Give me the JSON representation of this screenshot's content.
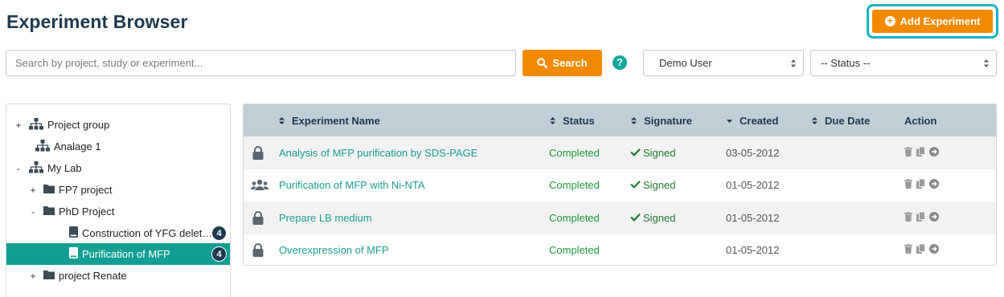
{
  "page": {
    "title": "Experiment Browser",
    "add_button_label": "Add Experiment",
    "accent_color": "#f28a00",
    "teal_color": "#129e93"
  },
  "search": {
    "placeholder": "Search by project, study or experiment...",
    "button_label": "Search",
    "help_label": "?"
  },
  "filters": {
    "user_value": "Demo User",
    "status_value": "-- Status --"
  },
  "tree": {
    "items": [
      {
        "label": "Project group",
        "toggle": "+",
        "icon": "hierarchy-icon"
      },
      {
        "label": "Analage 1",
        "toggle": "",
        "icon": "hierarchy-icon"
      },
      {
        "label": "My Lab",
        "toggle": "-",
        "icon": "hierarchy-icon"
      },
      {
        "label": "FP7 project",
        "toggle": "+",
        "icon": "folder-icon"
      },
      {
        "label": "PhD Project",
        "toggle": "-",
        "icon": "folder-icon"
      },
      {
        "label": "Construction of YFG delet…",
        "toggle": "",
        "icon": "notebook-icon",
        "badge": "4"
      },
      {
        "label": "Purification of MFP",
        "toggle": "",
        "icon": "notebook-icon",
        "badge": "4",
        "selected": true
      },
      {
        "label": "project Renate",
        "toggle": "+",
        "icon": "folder-icon"
      }
    ]
  },
  "table": {
    "columns": [
      "Experiment Name",
      "Status",
      "Signature",
      "Created",
      "Due Date",
      "Action"
    ],
    "rows": [
      {
        "icon": "lock-icon",
        "name": "Analysis of MFP purification by SDS-PAGE",
        "status": "Completed",
        "signature": "Signed",
        "created": "03-05-2012",
        "due": ""
      },
      {
        "icon": "users-icon",
        "name": "Purification of MFP with Ni-NTA",
        "status": "Completed",
        "signature": "Signed",
        "created": "01-05-2012",
        "due": ""
      },
      {
        "icon": "lock-icon",
        "name": "Prepare LB medium",
        "status": "Completed",
        "signature": "Signed",
        "created": "01-05-2012",
        "due": ""
      },
      {
        "icon": "lock-icon",
        "name": "Overexpression of MFP",
        "status": "Completed",
        "signature": "",
        "created": "01-05-2012",
        "due": ""
      }
    ]
  }
}
